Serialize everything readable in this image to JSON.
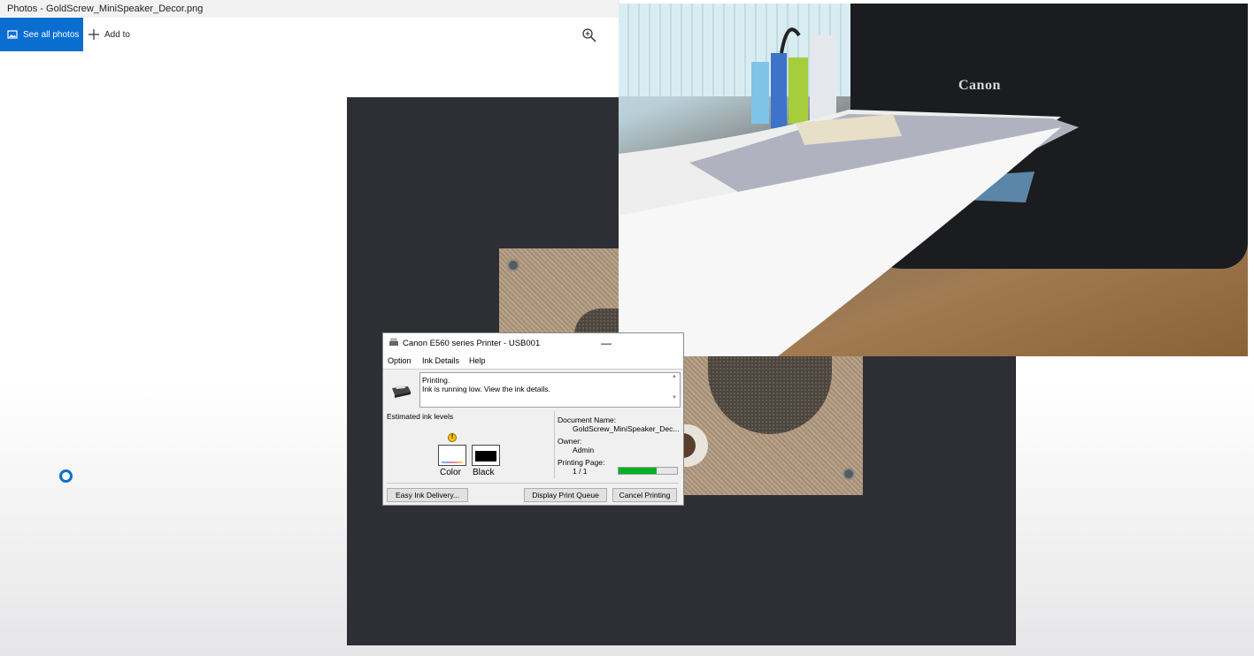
{
  "window": {
    "title": "Photos - GoldScrew_MiniSpeaker_Decor.png"
  },
  "toolbar": {
    "see_all_label": "See all photos",
    "add_to_label": "Add to",
    "zoom_icon": "zoom-in-icon"
  },
  "webcam": {
    "brand_text": "Canon"
  },
  "printer_dialog": {
    "title": "Canon E560 series Printer - USB001",
    "menu": [
      "Option",
      "Ink Details",
      "Help"
    ],
    "status_line1": "Printing.",
    "status_line2": "Ink is running low. View the ink details.",
    "ink_section_label": "Estimated ink levels",
    "ink": {
      "color_label": "Color",
      "black_label": "Black",
      "warning": "!"
    },
    "document_name_label": "Document Name:",
    "document_name_value": "GoldScrew_MiniSpeaker_Dec...",
    "owner_label": "Owner:",
    "owner_value": "Admin",
    "printing_page_label": "Printing Page:",
    "printing_page_value": "1 / 1",
    "progress_fraction": 0.65,
    "buttons": {
      "easy_ink": "Easy Ink Delivery...",
      "display_queue": "Display Print Queue",
      "cancel": "Cancel Printing"
    },
    "colors": {
      "progress": "#06b025"
    }
  },
  "colors": {
    "accent": "#0a6ed1",
    "canvas": "#2e2f35"
  }
}
